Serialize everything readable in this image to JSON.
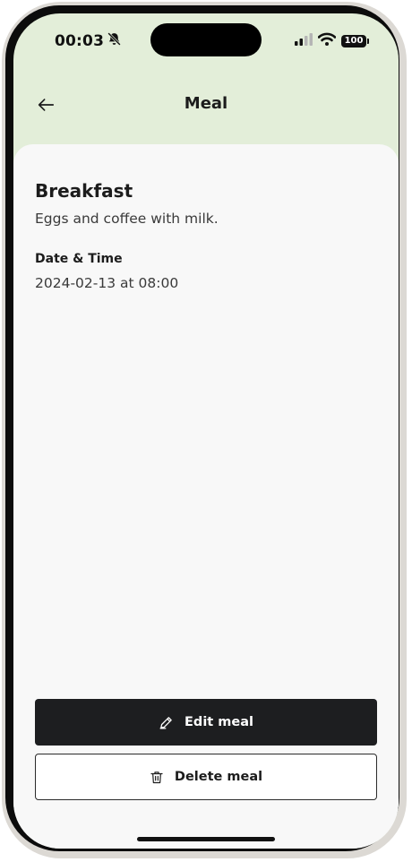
{
  "status_bar": {
    "time": "00:03",
    "battery_level": "100"
  },
  "header": {
    "title": "Meal"
  },
  "meal": {
    "title": "Breakfast",
    "description": "Eggs and coffee with milk.",
    "datetime_label": "Date & Time",
    "datetime_value": "2024-02-13 at 08:00"
  },
  "actions": {
    "edit_label": "Edit meal",
    "delete_label": "Delete meal"
  },
  "icons": {
    "back": "arrow-left-icon",
    "edit": "pencil-icon",
    "delete": "trash-icon",
    "silent": "bell-slash-icon",
    "signal": "cellular-signal-icon",
    "wifi": "wifi-icon",
    "battery": "battery-icon"
  },
  "colors": {
    "header_background": "#e3eed9",
    "content_background": "#f8f8f8",
    "primary_button": "#1d1e20",
    "text_primary": "#1c1c1c"
  }
}
